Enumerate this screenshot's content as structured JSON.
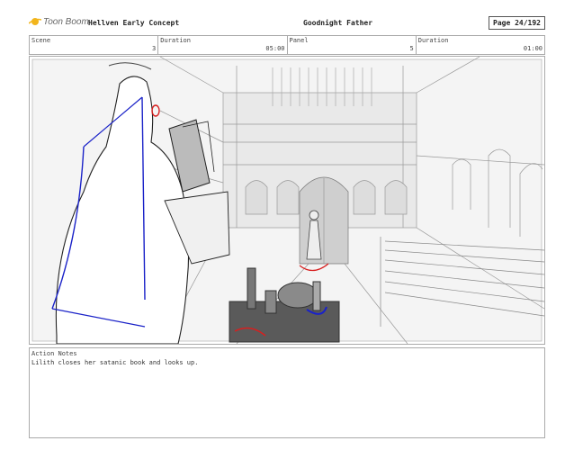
{
  "header": {
    "logo_text": "Toon Boom",
    "project": "Hellven  Early Concept",
    "title": "Goodnight Father",
    "page": "Page  24/192"
  },
  "info": {
    "scene_label": "Scene",
    "scene_value": "3",
    "duration1_label": "Duration",
    "duration1_value": "05:00",
    "panel_label": "Panel",
    "panel_value": "5",
    "duration2_label": "Duration",
    "duration2_value": "01:00"
  },
  "notes": {
    "label": "Action Notes",
    "text": "Lilith closes her satanic book and looks up."
  },
  "colors": {
    "logo": "#f2b51c",
    "sketch_blue": "#1a22c8",
    "sketch_red": "#d81e1e",
    "border": "#aaaaaa"
  }
}
